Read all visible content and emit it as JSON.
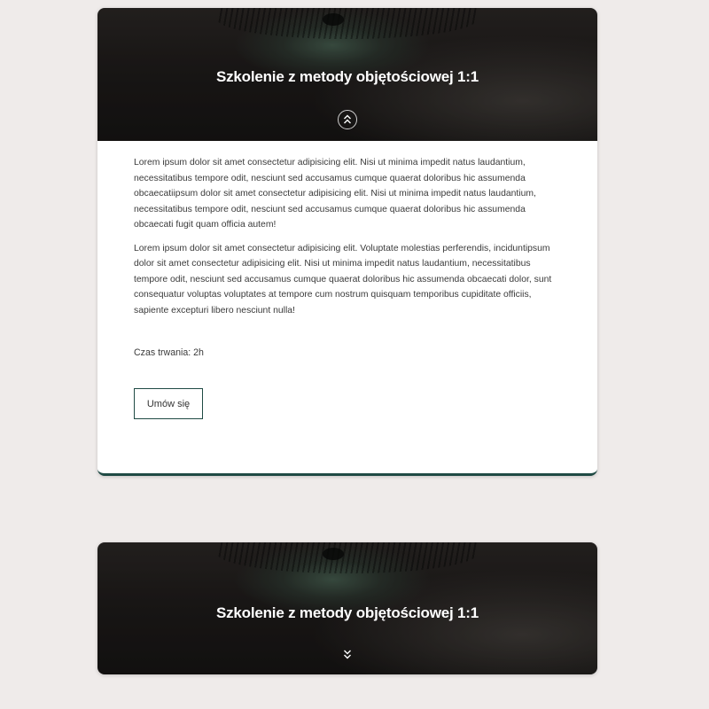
{
  "courses": [
    {
      "title": "Szkolenie z metody objętościowej 1:1",
      "toggle_icon": "chevrons-up-icon",
      "expanded": true,
      "paragraphs": [
        "Lorem ipsum dolor sit amet consectetur adipisicing elit. Nisi ut minima impedit natus laudantium, necessitatibus tempore odit, nesciunt sed accusamus cumque quaerat doloribus hic assumenda obcaecatiipsum dolor sit amet consectetur adipisicing elit. Nisi ut minima impedit natus laudantium, necessitatibus tempore odit, nesciunt sed accusamus cumque quaerat doloribus hic assumenda obcaecati fugit quam officia autem!",
        "Lorem ipsum dolor sit amet consectetur adipisicing elit. Voluptate molestias perferendis, inciduntipsum dolor sit amet consectetur adipisicing elit. Nisi ut minima impedit natus laudantium, necessitatibus tempore odit, nesciunt sed accusamus cumque quaerat doloribus hic assumenda obcaecati dolor, sunt consequatur voluptas voluptates at tempore cum nostrum quisquam temporibus cupiditate officiis, sapiente excepturi libero nesciunt nulla!"
      ],
      "duration": "Czas trwania: 2h",
      "button_label": "Umów się"
    },
    {
      "title": "Szkolenie z metody objętościowej 1:1",
      "toggle_icon": "chevrons-down-icon",
      "expanded": false
    }
  ],
  "colors": {
    "page_bg": "#efebea",
    "accent": "#1f4a44",
    "title_text": "#ffffff"
  }
}
